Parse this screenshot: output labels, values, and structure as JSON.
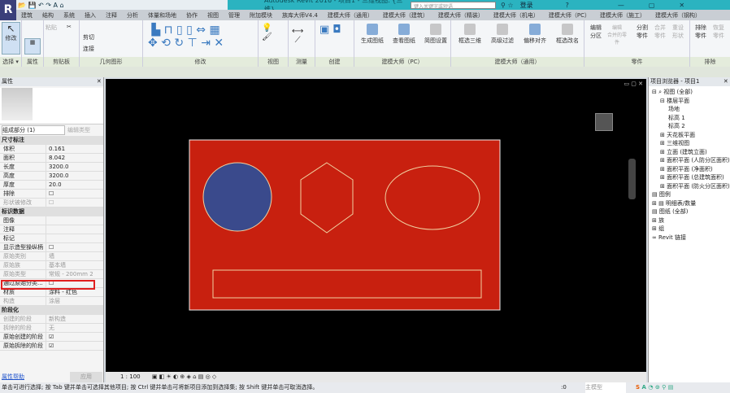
{
  "app": {
    "title": "Autodesk Revit 2016 -    项目1 - 三维视图: {三维}",
    "search_placeholder": "键入关键字或短语",
    "login": "登录"
  },
  "tabs": [
    "建筑",
    "结构",
    "系统",
    "插入",
    "注释",
    "分析",
    "体量和场地",
    "协作",
    "视图",
    "管理",
    "附加模块",
    "族库大师V4.4",
    "建模大师（通用）",
    "建模大师（建筑）",
    "建模大师（精装）",
    "建模大师（机电）",
    "建模大师（PC）",
    "建模大师（施工）",
    "建模大师（钢构）"
  ],
  "ribbon": {
    "modify": "修改",
    "paste": "粘贴",
    "cut": "剪切",
    "join": "连接",
    "panels": [
      "选择 ▾",
      "属性",
      "剪贴板",
      "几何图形",
      "修改",
      "视图",
      "测量",
      "创建",
      "建模大师（PC）",
      "建模大师（通用）",
      "零件",
      "排除"
    ],
    "pc_buttons": [
      "生成图纸",
      "查看图纸",
      "简图设置"
    ],
    "general_buttons": [
      "框选三维",
      "高级过滤",
      "偏移对齐",
      "框选改名"
    ],
    "part_buttons": [
      "编辑\n分区",
      "编辑\n合并的零件",
      "分割\n零件",
      "合并\n零件",
      "重设\n形状",
      "排除\n零件",
      "恢复\n零件"
    ]
  },
  "properties": {
    "title": "属性",
    "type_selector": "组成部分 (1)",
    "edit_type": "编辑类型",
    "sections": [
      {
        "name": "尺寸标注",
        "rows": [
          [
            "体积",
            "0.161",
            false
          ],
          [
            "面积",
            "8.042",
            false
          ],
          [
            "长度",
            "3200.0",
            false
          ],
          [
            "高度",
            "3200.0",
            false
          ],
          [
            "厚度",
            "20.0",
            false
          ],
          [
            "排除",
            "☐",
            false
          ],
          [
            "形状被修改",
            "☐",
            true
          ]
        ]
      },
      {
        "name": "标识数据",
        "rows": [
          [
            "图像",
            "",
            false
          ],
          [
            "注释",
            "",
            false
          ],
          [
            "标记",
            "",
            false
          ],
          [
            "显示造型操纵柄",
            "☐",
            false
          ],
          [
            "原始类别",
            "墙",
            true
          ],
          [
            "原始族",
            "基本墙",
            true
          ],
          [
            "原始类型",
            "常规 - 200mm 2",
            true
          ],
          [
            "通过原始分类...",
            "☐",
            false
          ],
          [
            "材质",
            "涂料 - 红色",
            false
          ],
          [
            "构造",
            "涂层",
            true
          ]
        ]
      },
      {
        "name": "阶段化",
        "rows": [
          [
            "创建的阶段",
            "新构造",
            true
          ],
          [
            "拆除的阶段",
            "无",
            true
          ],
          [
            "原始创建的阶段",
            "☑",
            false
          ],
          [
            "原始拆除的阶段",
            "☑",
            false
          ]
        ]
      }
    ],
    "help": "属性帮助",
    "apply": "应用"
  },
  "browser": {
    "title": "项目浏览器 - 项目1",
    "items": [
      {
        "label": "⊟ ⌕ 视图 (全部)",
        "indent": 0
      },
      {
        "label": "⊟ 楼层平面",
        "indent": 1
      },
      {
        "label": "场地",
        "indent": 2
      },
      {
        "label": "标高 1",
        "indent": 2
      },
      {
        "label": "标高 2",
        "indent": 2
      },
      {
        "label": "⊞ 天花板平面",
        "indent": 1
      },
      {
        "label": "⊞ 三维视图",
        "indent": 1
      },
      {
        "label": "⊞ 立面 (建筑立面)",
        "indent": 1
      },
      {
        "label": "⊞ 面积平面 (人防分区面积)",
        "indent": 1
      },
      {
        "label": "⊞ 面积平面 (净面积)",
        "indent": 1
      },
      {
        "label": "⊞ 面积平面 (总建筑面积)",
        "indent": 1
      },
      {
        "label": "⊞ 面积平面 (防火分区面积)",
        "indent": 1
      },
      {
        "label": "▤ 图例",
        "indent": 0
      },
      {
        "label": "⊞ ▤ 明细表/数量",
        "indent": 0
      },
      {
        "label": "▤ 图纸 (全部)",
        "indent": 0
      },
      {
        "label": "⊞ 族",
        "indent": 0
      },
      {
        "label": "⊞ 组",
        "indent": 0
      },
      {
        "label": "∞ Revit 链接",
        "indent": 0
      }
    ]
  },
  "view": {
    "scale": "1 : 100",
    "colors": {
      "wall": "#c8200f",
      "circle": "#3a4a8c",
      "outline": "#f0d0a0"
    }
  },
  "status": {
    "text": "单击可进行选择; 按 Tab 键并单击可选择其他项目; 按 Ctrl 键并单击可将新项目添加到选择集; 按 Shift 键并单击可取消选择。",
    "zero": ":0",
    "model": "主模型"
  }
}
